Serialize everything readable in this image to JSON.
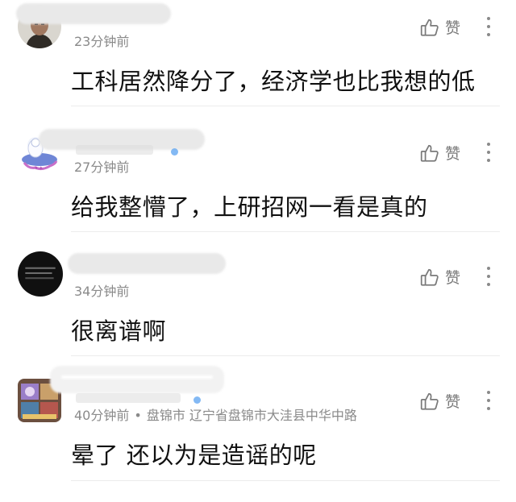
{
  "comments": [
    {
      "time": "23分钟前",
      "location": "",
      "text": "工科居然降分了，经济学也比我想的低",
      "like_label": "赞",
      "avatar": "man-portrait"
    },
    {
      "time": "27分钟前",
      "location": "",
      "text": "给我整懵了，上研招网一看是真的",
      "like_label": "赞",
      "avatar": "cartoon-figure"
    },
    {
      "time": "34分钟前",
      "location": "",
      "text": "很离谱啊",
      "like_label": "赞",
      "avatar": "dark-text-image"
    },
    {
      "time": "40分钟前",
      "location": "盘锦市 辽宁省盘锦市大洼县中华中路",
      "text": "晕了 还以为是造谣的呢",
      "like_label": "赞",
      "avatar": "colorful-game"
    }
  ],
  "icons": {
    "like": "thumbs-up-icon",
    "more": "more-vertical-icon"
  },
  "colors": {
    "text": "#111111",
    "meta": "#8a8a8a",
    "blue_badge": "#5aa2f0"
  }
}
